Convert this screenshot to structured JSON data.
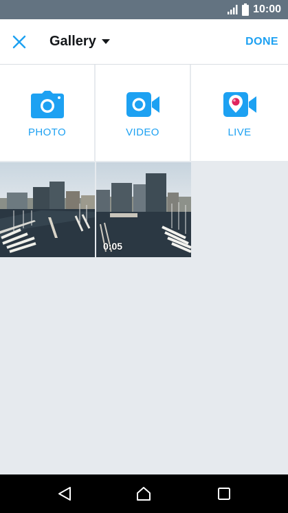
{
  "status_bar": {
    "time": "10:00"
  },
  "header": {
    "title": "Gallery",
    "done_label": "DONE"
  },
  "tiles": [
    {
      "label": "PHOTO",
      "icon": "camera-icon"
    },
    {
      "label": "VIDEO",
      "icon": "video-camera-icon"
    },
    {
      "label": "LIVE",
      "icon": "periscope-live-icon"
    }
  ],
  "media": [
    {
      "type": "photo"
    },
    {
      "type": "video",
      "duration": "0:05"
    }
  ],
  "colors": {
    "accent": "#1da1f2",
    "status_bar": "#637381",
    "background": "#e6eaee"
  }
}
